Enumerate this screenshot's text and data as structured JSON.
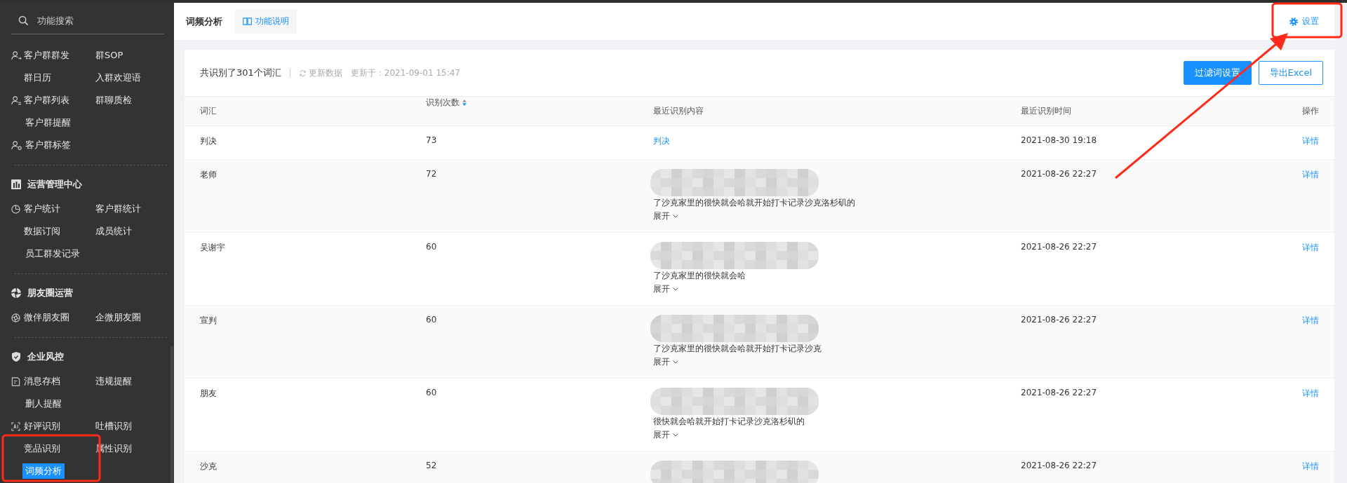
{
  "sidebar": {
    "search": {
      "placeholder": "功能搜索"
    },
    "sections": [
      {
        "rows": [
          {
            "kind": "people",
            "items": [
              {
                "label": "客户群群发",
                "selected": false
              },
              {
                "label": "群SOP",
                "selected": false
              }
            ]
          },
          {
            "kind": "plain",
            "items": [
              {
                "label": "群日历",
                "selected": false
              },
              {
                "label": "入群欢迎语",
                "selected": false
              }
            ]
          },
          {
            "kind": "people-list",
            "items": [
              {
                "label": "客户群列表",
                "selected": false
              },
              {
                "label": "群聊质检",
                "selected": false
              }
            ]
          },
          {
            "kind": "plain",
            "items": [
              {
                "label": "客户群提醒",
                "selected": false
              }
            ]
          },
          {
            "kind": "people-tag",
            "items": [
              {
                "label": "客户群标签",
                "selected": false
              }
            ]
          }
        ]
      },
      {
        "title": "运营管理中心",
        "kind": "chart",
        "rows": [
          {
            "kind": "pie",
            "items": [
              {
                "label": "客户统计",
                "selected": false
              },
              {
                "label": "客户群统计",
                "selected": false
              }
            ]
          },
          {
            "kind": "plain",
            "items": [
              {
                "label": "数据订阅",
                "selected": false
              },
              {
                "label": "成员统计",
                "selected": false
              }
            ]
          },
          {
            "kind": "plain",
            "items": [
              {
                "label": "员工群发记录",
                "selected": false
              }
            ]
          }
        ]
      },
      {
        "title": "朋友圈运营",
        "kind": "aperture",
        "rows": [
          {
            "kind": "aperture",
            "items": [
              {
                "label": "微伴朋友圈",
                "selected": false
              },
              {
                "label": "企微朋友圈",
                "selected": false
              }
            ]
          }
        ]
      },
      {
        "title": "企业风控",
        "kind": "shield",
        "rows": [
          {
            "kind": "doc",
            "items": [
              {
                "label": "消息存档",
                "selected": false
              },
              {
                "label": "违规提醒",
                "selected": false
              }
            ]
          },
          {
            "kind": "plain",
            "items": [
              {
                "label": "删人提醒",
                "selected": false
              }
            ]
          },
          {
            "kind": "ai",
            "items": [
              {
                "label": "好评识别",
                "selected": false
              },
              {
                "label": "吐槽识别",
                "selected": false
              }
            ]
          },
          {
            "kind": "plain",
            "items": [
              {
                "label": "竞品识别",
                "selected": false
              },
              {
                "label": "属性识别",
                "selected": false
              }
            ]
          },
          {
            "kind": "plain",
            "items": [
              {
                "label": "词频分析",
                "selected": true
              }
            ]
          }
        ]
      }
    ]
  },
  "header": {
    "title": "词频分析",
    "help": "功能说明",
    "settings": "设置"
  },
  "summary": {
    "total": "共识别了301个词汇",
    "refresh": "更新数据",
    "updated": "更新于：2021-09-01 15:47"
  },
  "buttons": [
    {
      "label": "过滤词设置",
      "kind": "primary"
    },
    {
      "label": "导出Excel",
      "kind": "outline"
    }
  ],
  "table": {
    "columns": [
      "词汇",
      "识别次数",
      "最近识别内容",
      "最近识别时间",
      "操作"
    ],
    "rows": [
      {
        "word": "判决",
        "count": "73",
        "content": {
          "kind": "link",
          "text": "判决"
        },
        "time": "2021-08-30 19:18",
        "action": "详情"
      },
      {
        "word": "老师",
        "count": "72",
        "content": {
          "kind": "redacted",
          "lines": [
            "了沙克家里的很快就会哈就开始打卡记录沙克洛杉矶的"
          ]
        },
        "expand": "展开",
        "time": "2021-08-26 22:27",
        "action": "详情"
      },
      {
        "word": "吴谢宇",
        "count": "60",
        "content": {
          "kind": "redacted",
          "lines": [
            "了沙克家里的很快就会哈"
          ]
        },
        "expand": "展开",
        "time": "2021-08-26 22:27",
        "action": "详情"
      },
      {
        "word": "宣判",
        "count": "60",
        "content": {
          "kind": "redacted",
          "lines": [
            "了沙克家里的很快就会哈就开始打卡记录沙克"
          ]
        },
        "expand": "展开",
        "time": "2021-08-26 22:27",
        "action": "详情"
      },
      {
        "word": "朋友",
        "count": "60",
        "content": {
          "kind": "redacted",
          "lines": [
            "很快就会哈就开始打卡记录沙克洛杉矶的"
          ]
        },
        "expand": "展开",
        "time": "2021-08-26 22:27",
        "action": "详情"
      },
      {
        "word": "沙克",
        "count": "52",
        "content": {
          "kind": "redacted"
        },
        "time": "2021-08-26 22:27",
        "action": "详情"
      }
    ]
  }
}
